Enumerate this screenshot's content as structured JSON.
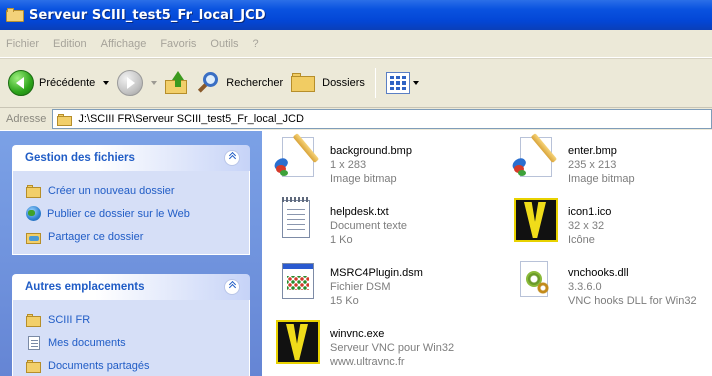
{
  "window": {
    "title": "Serveur SCIII_test5_Fr_local_JCD"
  },
  "menu": {
    "items": [
      "Fichier",
      "Edition",
      "Affichage",
      "Favoris",
      "Outils",
      "?"
    ]
  },
  "toolbar": {
    "back_label": "Précédente",
    "search_label": "Rechercher",
    "folders_label": "Dossiers"
  },
  "address": {
    "label": "Adresse",
    "value": "J:\\SCIII FR\\Serveur SCIII_test5_Fr_local_JCD"
  },
  "tasks": {
    "title": "Gestion des fichiers",
    "items": [
      "Créer un nouveau dossier",
      "Publier ce dossier sur le Web",
      "Partager ce dossier"
    ]
  },
  "places": {
    "title": "Autres emplacements",
    "items": [
      "SCIII FR",
      "Mes documents",
      "Documents partagés"
    ]
  },
  "files": [
    {
      "name": "background.bmp",
      "line1": "1 x 283",
      "line2": "Image bitmap",
      "icon": "paint-bitmap-icon"
    },
    {
      "name": "enter.bmp",
      "line1": "235 x 213",
      "line2": "Image bitmap",
      "icon": "paint-bitmap-icon"
    },
    {
      "name": "helpdesk.txt",
      "line1": "Document texte",
      "line2": "1 Ko",
      "icon": "notepad-icon"
    },
    {
      "name": "icon1.ico",
      "line1": "32 x 32",
      "line2": "Icône",
      "icon": "vnc-icon"
    },
    {
      "name": "MSRC4Plugin.dsm",
      "line1": "Fichier DSM",
      "line2": "15 Ko",
      "icon": "dsm-file-icon"
    },
    {
      "name": "vnchooks.dll",
      "line1": "3.3.6.0",
      "line2": "VNC hooks DLL for Win32",
      "icon": "dll-gears-icon"
    },
    {
      "name": "winvnc.exe",
      "line1": "Serveur VNC pour Win32",
      "line2": "www.ultravnc.fr",
      "icon": "vnc-icon"
    }
  ]
}
